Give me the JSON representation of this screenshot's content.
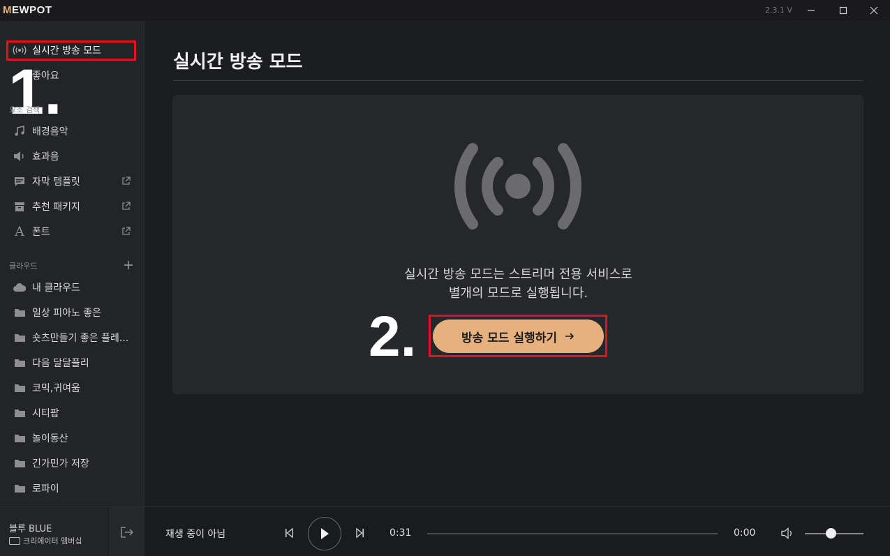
{
  "app": {
    "logo": "MEWPOT",
    "version": "2.3.1 V"
  },
  "sidebar": {
    "live_mode": "실시간 방송 모드",
    "likes": "좋아요",
    "section_search": "요소 검색",
    "items": [
      {
        "label": "배경음악",
        "icon": "music-note-icon",
        "external": false
      },
      {
        "label": "효과음",
        "icon": "speaker-icon",
        "external": false
      },
      {
        "label": "자막 템플릿",
        "icon": "subtitle-icon",
        "external": true
      },
      {
        "label": "추천 패키지",
        "icon": "package-icon",
        "external": true
      },
      {
        "label": "폰트",
        "icon": "font-icon",
        "external": true
      }
    ],
    "section_cloud": "클라우드",
    "cloud_items": [
      {
        "label": "내 클라우드",
        "icon": "cloud-icon"
      },
      {
        "label": "일상 피아노 좋은",
        "icon": "folder-icon"
      },
      {
        "label": "숏츠만들기 좋은 플레...",
        "icon": "folder-icon"
      },
      {
        "label": "다음 달달플리",
        "icon": "folder-icon"
      },
      {
        "label": "코믹,귀여움",
        "icon": "folder-icon"
      },
      {
        "label": "시티팝",
        "icon": "folder-icon"
      },
      {
        "label": "놀이동산",
        "icon": "folder-icon"
      },
      {
        "label": "긴가민가 저장",
        "icon": "folder-icon"
      },
      {
        "label": "로파이",
        "icon": "folder-icon"
      }
    ]
  },
  "annotations": {
    "step1": "1.",
    "step2": "2.",
    "highlight_color": "#e8101a"
  },
  "main": {
    "title": "실시간 방송 모드",
    "description_line1": "실시간 방송 모드는 스트리머 전용 서비스로",
    "description_line2": "별개의 모드로 실행됩니다.",
    "launch_button": "방송 모드 실행하기",
    "accent": "#e7b07f"
  },
  "player": {
    "user_name": "블루 BLUE",
    "user_badge": "크리에이터 멤버십",
    "status": "재생 중이 아님",
    "elapsed": "0:31",
    "duration": "0:00",
    "volume_level": 0.45
  }
}
